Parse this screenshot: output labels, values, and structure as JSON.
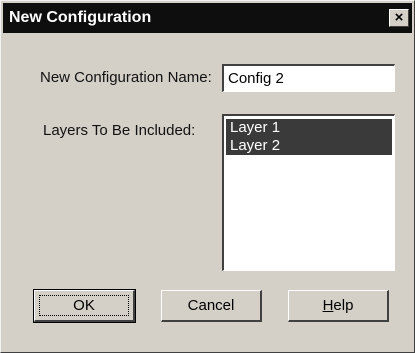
{
  "window": {
    "title": "New Configuration",
    "close_glyph": "×"
  },
  "form": {
    "name_label": "New Configuration Name:",
    "name_value": "Config 2",
    "layers_label": "Layers To Be Included:",
    "layers": [
      {
        "label": "Layer 1",
        "selected": true
      },
      {
        "label": "Layer 2",
        "selected": true
      }
    ]
  },
  "buttons": {
    "ok_label": "OK",
    "cancel_label": "Cancel",
    "help_mnemonic": "H",
    "help_rest": "elp"
  },
  "colors": {
    "dialog_bg": "#d4d0c8",
    "titlebar_bg": "#0e0e0e",
    "selection_bg": "#3a3a3a"
  },
  "icons": {
    "close": "close-icon"
  }
}
